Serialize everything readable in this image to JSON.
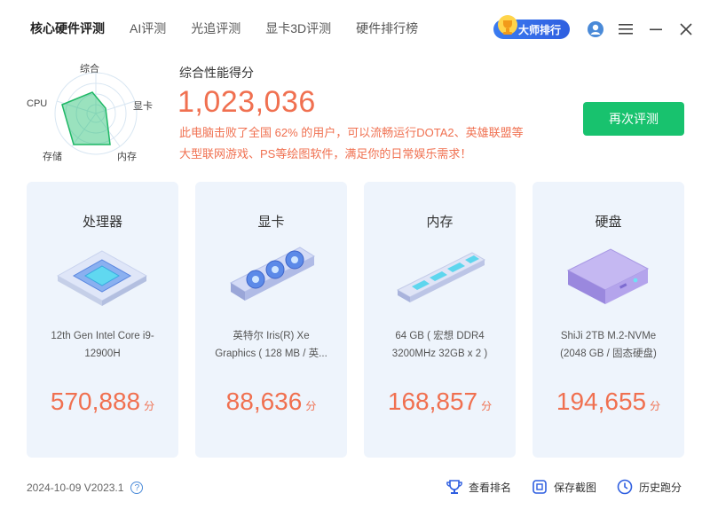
{
  "nav": {
    "tabs": [
      {
        "label": "核心硬件评测"
      },
      {
        "label": "AI评测"
      },
      {
        "label": "光追评测"
      },
      {
        "label": "显卡3D评测"
      },
      {
        "label": "硬件排行榜"
      }
    ],
    "master_rank_label": "大师排行"
  },
  "radar": {
    "labels": {
      "top": "综合",
      "right": "显卡",
      "bottom_right": "内存",
      "bottom_left": "存储",
      "left": "CPU"
    }
  },
  "score": {
    "title": "综合性能得分",
    "value": "1,023,036",
    "desc_line1": "此电脑击败了全国 62% 的用户，可以流畅运行DOTA2、英雄联盟等",
    "desc_line2": "大型联网游戏、PS等绘图软件，满足你的日常娱乐需求！",
    "retest_label": "再次评测"
  },
  "cards": [
    {
      "title": "处理器",
      "line1": "12th Gen Intel Core i9-",
      "line2": "12900H",
      "score": "570,888",
      "unit": "分"
    },
    {
      "title": "显卡",
      "line1": "英特尔 Iris(R) Xe",
      "line2": "Graphics ( 128 MB / 英...",
      "score": "88,636",
      "unit": "分"
    },
    {
      "title": "内存",
      "line1": "64 GB ( 宏想 DDR4",
      "line2": "3200MHz 32GB x 2 )",
      "score": "168,857",
      "unit": "分"
    },
    {
      "title": "硬盘",
      "line1": "ShiJi 2TB M.2-NVMe",
      "line2": "(2048 GB / 固态硬盘)",
      "score": "194,655",
      "unit": "分"
    }
  ],
  "footer": {
    "version": "2024-10-09 V2023.1",
    "help": "?",
    "actions": [
      {
        "label": "查看排名",
        "icon": "trophy-icon"
      },
      {
        "label": "保存截图",
        "icon": "screenshot-icon"
      },
      {
        "label": "历史跑分",
        "icon": "history-icon"
      }
    ]
  },
  "colors": {
    "accent_score": "#f07050",
    "primary_green": "#18c26e",
    "card_bg": "#eef4fc",
    "brand_blue": "#2f5fe0"
  }
}
